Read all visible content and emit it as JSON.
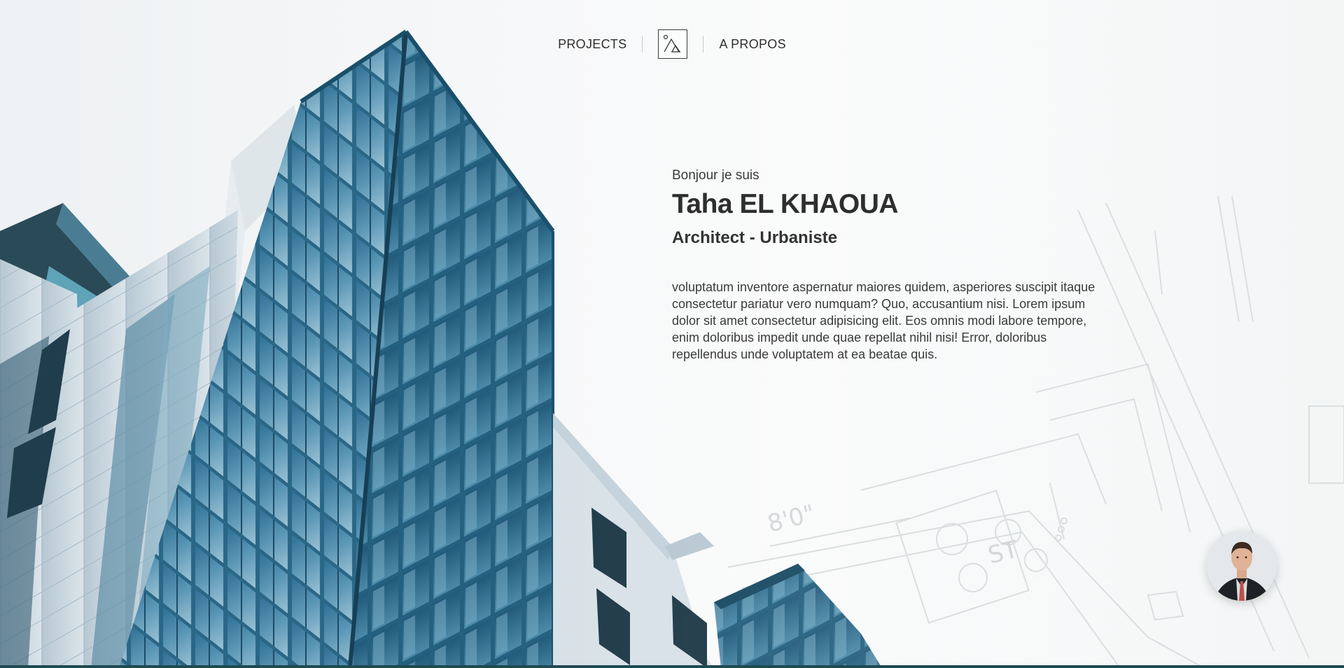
{
  "nav": {
    "projects_label": "PROJECTS",
    "about_label": "A PROPOS",
    "logo_icon": "mountain-logo-icon"
  },
  "hero": {
    "greeting": "Bonjour je suis",
    "name": "Taha EL KHAOUA",
    "role": "Architect - Urbaniste",
    "bio": "voluptatum inventore aspernatur maiores quidem, asperiores suscipit itaque consectetur pariatur vero numquam? Quo, accusantium nisi. Lorem ipsum dolor sit amet consectetur adipisicing elit. Eos omnis modi labore tempore, enim doloribus impedit unde quae repellat nihil nisi! Error, doloribus repellendus unde voluptatem at ea beatae quis."
  },
  "blueprint": {
    "dimension_label": "8'0\"",
    "room_label": "ST"
  },
  "colors": {
    "accent": "#1f4a52",
    "glass": "#4d86a6",
    "text": "#333333"
  }
}
